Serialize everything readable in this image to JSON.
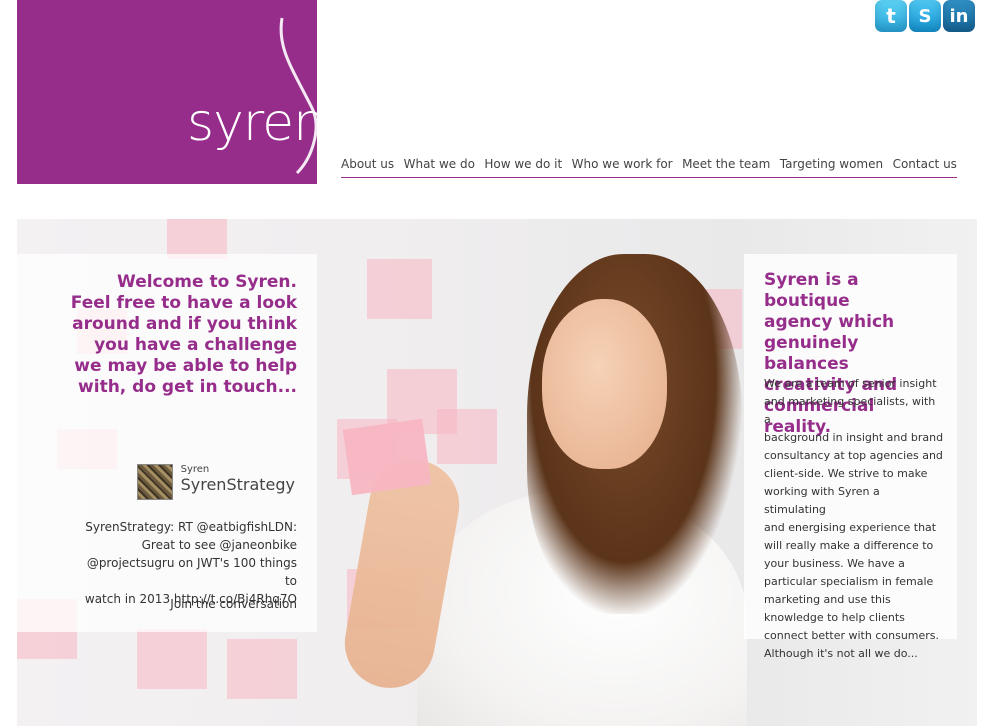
{
  "brand": {
    "logo_text": "syren",
    "accent_color": "#962d8b"
  },
  "social": {
    "twitter_icon": "t",
    "skype_icon": "S",
    "linkedin_icon": "in"
  },
  "nav": {
    "items": [
      "About us",
      "What we do",
      "How we do it",
      "Who we work for",
      "Meet the team",
      "Targeting women",
      "Contact us"
    ]
  },
  "hero": {
    "welcome_lines": [
      "Welcome to Syren.",
      "Feel free to have a look",
      "around and if you think",
      "you have a challenge",
      "we may be able to help",
      "with, do get in touch..."
    ],
    "tweet": {
      "name_small": "Syren",
      "name_big": "SyrenStrategy",
      "text_lines": [
        "SyrenStrategy: RT @eatbigfishLDN:",
        "Great to see @janeonbike",
        "@projectsugru on JWT's 100 things to",
        "watch in 2013 http://t.co/Bi4Rhq7O"
      ],
      "join": "Join the conversation"
    },
    "right": {
      "title_lines": [
        "Syren is a boutique",
        "agency which",
        "genuinely balances",
        "creativity and",
        "commercial reality."
      ],
      "body_lines": [
        "We are a team of senior insight",
        "and marketing specialists, with a",
        "background in insight and brand",
        "consultancy at top agencies and",
        "client-side. We strive to make",
        "working with Syren a stimulating",
        "and energising experience that",
        "will really make a difference to",
        "your business. We have a",
        "particular specialism in female",
        "marketing and use this",
        "knowledge to help clients",
        "connect better with consumers.",
        "Although it's not all we do..."
      ]
    }
  }
}
